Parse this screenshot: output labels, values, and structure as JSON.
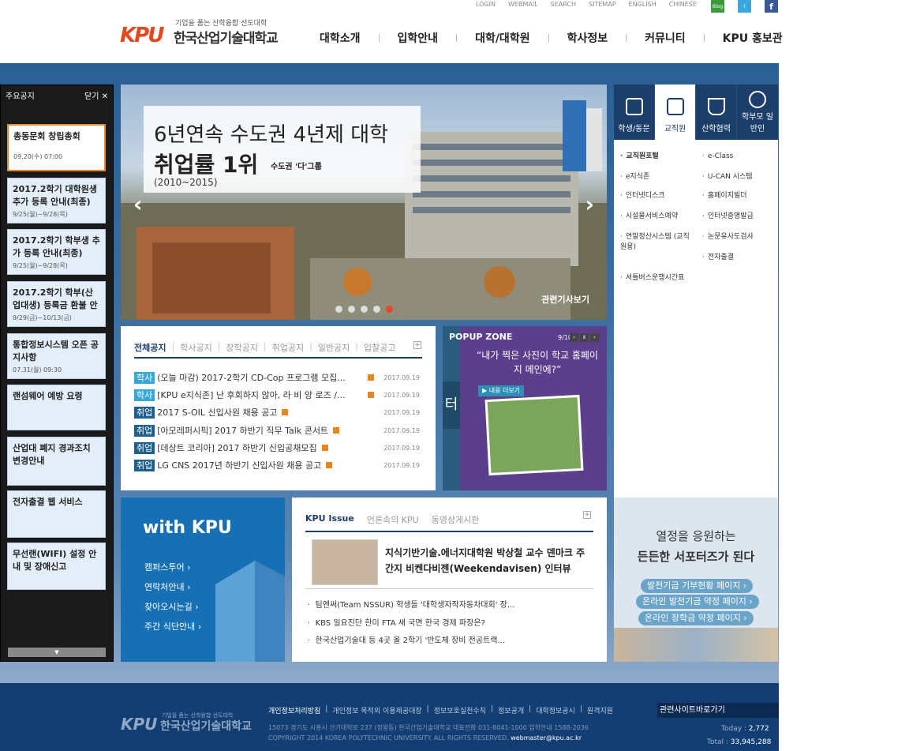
{
  "util_links": [
    "LOGIN",
    "WEBMAIL",
    "SEARCH",
    "SITEMAP",
    "ENGLISH",
    "CHINESE"
  ],
  "social": {
    "blog": "Blog"
  },
  "logo": {
    "slogan": "기업을 품는 산학융합 선도대학",
    "name": "한국산업기술대학교",
    "mark": "KPU"
  },
  "gnb": [
    "대학소개",
    "입학안내",
    "대학/대학원",
    "학사정보",
    "커뮤니티",
    "KPU 홍보관"
  ],
  "notice": {
    "title": "주요공지",
    "close": "닫기",
    "items": [
      {
        "title": "총동문회 창립총회",
        "date": "09.20(수) 07:00"
      },
      {
        "title": "2017.2학기 대학원생 추가 등록 안내(최종)",
        "date": "9/25(월)~9/28(목)"
      },
      {
        "title": "2017.2학기 학부생 추가 등록 안내(최종)",
        "date": "9/25(월)~9/28(목)"
      },
      {
        "title": "2017.2학기 학부(산업대생) 등록금 환불 안",
        "date": "9/29(금)~10/13(금)"
      },
      {
        "title": "통합정보시스템 오픈 공지사항",
        "date": "07.31(월) 09:30"
      },
      {
        "title": "랜섬웨어 예방 요령",
        "date": ""
      },
      {
        "title": "산업대 폐지 경과조치 변경안내",
        "date": ""
      },
      {
        "title": "전자출결 웹 서비스",
        "date": ""
      },
      {
        "title": "무선랜(WIFI) 설정 안내 및 장애신고",
        "date": ""
      }
    ]
  },
  "slide": {
    "line1": "6년연속 수도권 4년제 대학",
    "line2": "취업률 1위",
    "sub": "수도권 '다'그룹",
    "years": "(2010~2015)",
    "more": "관련기사보기"
  },
  "quick": {
    "tabs": [
      "학생/동문",
      "교직원",
      "산학협력",
      "학부모 일반인"
    ],
    "left": [
      "교직원포털",
      "e지식존",
      "인터넷디스크",
      "시설물서비스예약",
      "연말정산시스템 (교직원용)",
      "셔틀버스운행시간표"
    ],
    "right": [
      "e-Class",
      "U-CAN 시스템",
      "홈페이지빌더",
      "인터넷증명발급",
      "논문유사도검사",
      "전자출결"
    ]
  },
  "board": {
    "tabs": [
      "전체공지",
      "학사공지",
      "장학공지",
      "취업공지",
      "일반공지",
      "입찰공고"
    ],
    "rows": [
      {
        "tag": "학사",
        "title": "(오늘 마감) 2017-2학기 CD-Cop 프로그램 모집...",
        "date": "2017.09.19"
      },
      {
        "tag": "학사",
        "title": "[KPU e지식존] 난 후회하지 않아, 라 비 앙 로즈 /...",
        "date": "2017.09.19"
      },
      {
        "tag": "취업",
        "title": "2017 S-OIL 신입사원 채용 공고",
        "date": "2017.09.19"
      },
      {
        "tag": "취업",
        "title": "[아모레퍼시픽] 2017 하반기 직무 Talk 콘서트",
        "date": "2017.09.19"
      },
      {
        "tag": "취업",
        "title": "[데상트 코리아] 2017 하반기 신입공채모집",
        "date": "2017.09.19"
      },
      {
        "tag": "취업",
        "title": "LG CNS 2017년 하반기 신입사원 채용 공고",
        "date": "2017.09.19"
      }
    ]
  },
  "popup": {
    "title": "POPUP ZONE",
    "count": "9/10",
    "text": "“내가 찍은 사진이 학교 홈페이지 메인에?”",
    "more": "내용 더보기",
    "side": "터"
  },
  "withkpu": {
    "title": "with KPU",
    "links": [
      "캠퍼스투어",
      "연락처안내",
      "찾아오시는길",
      "주간 식단안내"
    ]
  },
  "issue": {
    "tabs": [
      "KPU Issue",
      "언론속의 KPU",
      "동영상게시판"
    ],
    "headline": "지식기반기술.에너지대학원 박상철 교수 덴마크 주간지 비켄다비젠(Weekendavisen) 인터뷰",
    "items": [
      "팀엔써(Team NSSUR) 학생들 '대학생자작자동차대회' 장...",
      "KBS 일요진단 한미 FTA 새 국면 한국 경제 파장은?",
      "한국산업기술대 등 4곳 올 2학기 '반도체 장비 전공트랙..."
    ]
  },
  "support": {
    "title1": "열정을 응원하는",
    "title2": "든든한 서포터즈가 된다",
    "buttons": [
      "발전기금 기부현황 페이지",
      "온라인 발전기금 약정 페이지",
      "온라인 장학금 약정 페이지"
    ]
  },
  "footer": {
    "links": [
      "개인정보처리방침",
      "개인정보 목적외 이용제공대장",
      "정보보호실천수칙",
      "정보공개",
      "대학정보공시",
      "원격지원"
    ],
    "address": "15073 경기도 시흥시 산기대학로 237 (정왕동) 한국산업기술대학교 대표전화 031-8041-1000 입학안내 1588-2036",
    "copyright": "COPYRIGHT 2014 KOREA POLYTECHNIC UNIVERSITY. ALL RIGHTS RESERVED.",
    "email": "webmaster@kpu.ac.kr",
    "related": "관련사이트바로가기",
    "today_label": "Today :",
    "today": "2,772",
    "total_label": "Total :",
    "total": "33,945,288"
  }
}
